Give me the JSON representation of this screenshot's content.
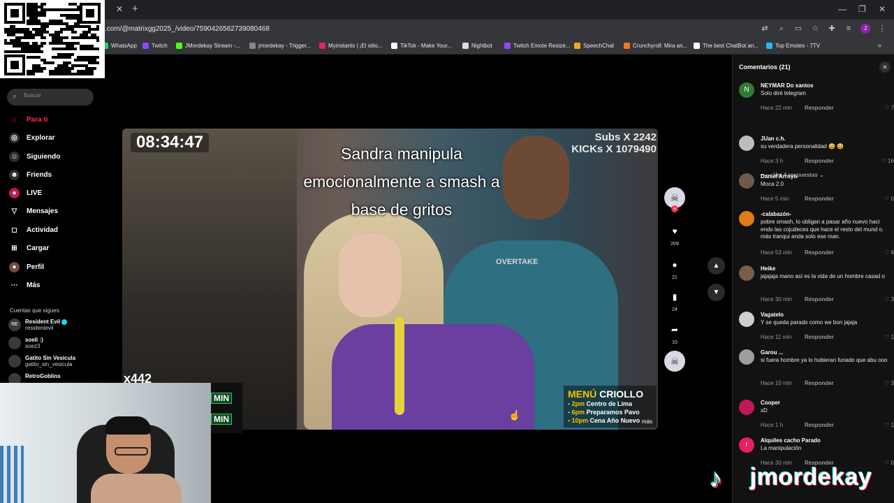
{
  "browser": {
    "url": ".com/@matrixgg2025_/video/7590426562739080468",
    "bookmarks": [
      {
        "label": "WhatsApp",
        "color": "#25d366"
      },
      {
        "label": "Twitch",
        "color": "#9146ff"
      },
      {
        "label": "JMordekay Stream -...",
        "color": "#53fc18"
      },
      {
        "label": "jmordekay - Trigger...",
        "color": "#888888"
      },
      {
        "label": "Myinstants | ¡El sitio...",
        "color": "#e0245e"
      },
      {
        "label": "TikTok - Make Your...",
        "color": "#ffffff"
      },
      {
        "label": "Nightbot",
        "color": "#dddddd"
      },
      {
        "label": "Twitch Emote Resize...",
        "color": "#9146ff"
      },
      {
        "label": "SpeechChat",
        "color": "#f5a623"
      },
      {
        "label": "Crunchyroll: Mira an...",
        "color": "#f47521"
      },
      {
        "label": "The best ChatBot an...",
        "color": "#ffffff"
      },
      {
        "label": "Top Emotes - 7TV",
        "color": "#29b6f6"
      }
    ],
    "profile_initial": "J"
  },
  "sidebar": {
    "search_placeholder": "Buscar",
    "nav": [
      {
        "label": "Para ti",
        "icon": "home-icon"
      },
      {
        "label": "Explorar",
        "icon": "compass-icon"
      },
      {
        "label": "Siguiendo",
        "icon": "following-icon"
      },
      {
        "label": "Friends",
        "icon": "friends-icon"
      },
      {
        "label": "LIVE",
        "icon": "live-icon"
      },
      {
        "label": "Mensajes",
        "icon": "messages-icon"
      },
      {
        "label": "Actividad",
        "icon": "activity-icon"
      },
      {
        "label": "Cargar",
        "icon": "upload-icon"
      },
      {
        "label": "Perfil",
        "icon": "profile-icon"
      },
      {
        "label": "Más",
        "icon": "more-icon"
      }
    ],
    "following_title": "Cuentas que sigues",
    "following": [
      {
        "name": "Resident Evil",
        "user": "residentevil",
        "avatar": "RE"
      },
      {
        "name": "soeli :)",
        "user": "soez3",
        "avatar": ""
      },
      {
        "name": "Gatito Sin Vesícula",
        "user": "gatito_sin_vesicula",
        "avatar": ""
      },
      {
        "name": "RetroGoblins",
        "user": "",
        "avatar": ""
      }
    ]
  },
  "video": {
    "timer": "08:34:47",
    "subs_line": "Subs X 2242",
    "kicks_line": "KICKs X 1079490",
    "caption": "Sandra manipula emocionalmente a smash a base de gritos",
    "left_tag": "x442",
    "shirt_text": "OVERTAKE",
    "menu_title_a": "MENÚ",
    "menu_title_b": "CRIOLLO",
    "menu_lines": [
      {
        "time": "2pm",
        "text": "Centro de Lima"
      },
      {
        "time": "6pm",
        "text": "Preparamos Pavo"
      },
      {
        "time": "10pm",
        "text": "Cena Año Nuevo"
      }
    ],
    "menu_more": "más",
    "min_tags": [
      "MIN",
      "MIN"
    ]
  },
  "actions": {
    "likes": "209",
    "comments": "21",
    "saves": "24",
    "shares": "10"
  },
  "comments_panel": {
    "title": "Comentarios (21)",
    "view_replies": "Ver 4 respuestas",
    "reply_label": "Responder",
    "items": [
      {
        "user": "NEYMAR Do santos",
        "text": "Solo diré telegram",
        "time": "Hace 22 min",
        "likes": "7",
        "avatar": "N",
        "color": "#2e7d32"
      },
      {
        "user": "JUan c.h.",
        "text": "su verdadera personalidad 😀 😀",
        "time": "Hace 3 h",
        "likes": "16",
        "avatar": "",
        "color": "#bdbdbd"
      },
      {
        "user": "Daniel Arroyo",
        "text": "Moca 2.0",
        "time": "Hace 5 min",
        "likes": "0",
        "avatar": "",
        "color": "#6d5a4a"
      },
      {
        "user": "-calabazón-",
        "text": "pobre smash, lo obligan a pasar año nuevo haci endo las cojudeces que hace el resto del mund o. más tranqui anda solo ese man.",
        "time": "Hace 53 min",
        "likes": "6",
        "avatar": "",
        "color": "#e07b1a"
      },
      {
        "user": "Heike",
        "text": "jajajaja mano así es la vida de un hombre casad o",
        "time": "Hace 30 min",
        "likes": "3",
        "avatar": "",
        "color": "#7a5c4a"
      },
      {
        "user": "Vagatelo",
        "text": "Y se queda parado como we bon jajaja",
        "time": "Hace 11 min",
        "likes": "1",
        "avatar": "",
        "color": "#cfcfcf"
      },
      {
        "user": "Garou ...",
        "text": "si fuera hombre ya lo hubieran funado que abu ooo",
        "time": "Hace 10 min",
        "likes": "3",
        "avatar": "",
        "color": "#9e9e9e"
      },
      {
        "user": "Cooper",
        "text": "xD",
        "time": "Hace 1 h",
        "likes": "1",
        "avatar": "",
        "color": "#c2185b"
      },
      {
        "user": "Alquiles cacho Parado",
        "text": "La manipulación",
        "time": "Hace 30 min",
        "likes": "0",
        "avatar": "r",
        "color": "#e91e63"
      }
    ]
  },
  "branding": {
    "name": "jmordekay"
  },
  "colors": {
    "accent": "#fe2c55",
    "tiktok_cyan": "#25f4ee"
  }
}
